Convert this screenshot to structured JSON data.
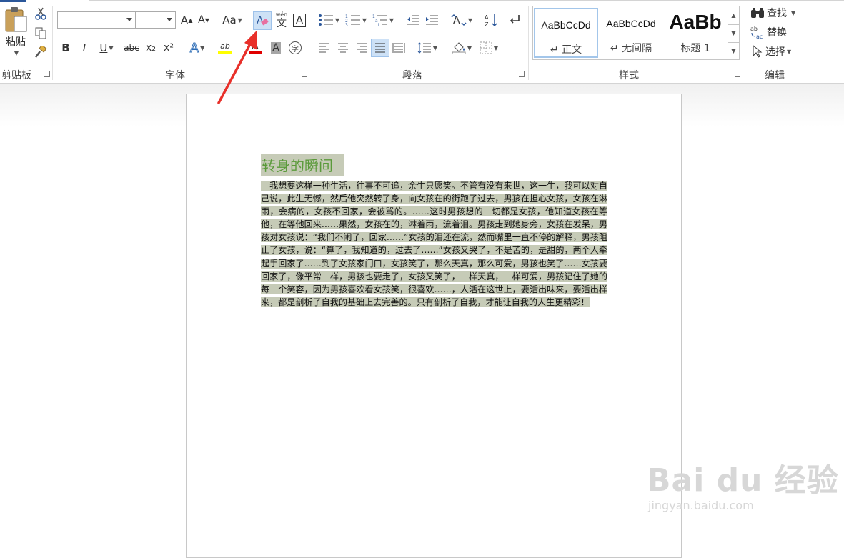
{
  "ribbon": {
    "clipboard": {
      "paste_label": "粘贴",
      "group_label": "剪贴板"
    },
    "font": {
      "font_name": "",
      "font_size": "",
      "grow_label": "A",
      "shrink_label": "A",
      "case_label": "Aa",
      "phonetic_top": "wén",
      "phonetic_bottom": "文",
      "border_char": "A",
      "bold": "B",
      "italic": "I",
      "underline": "U",
      "strike": "abc",
      "subscript": "x₂",
      "superscript": "x²",
      "effects": "A",
      "highlight": "ab",
      "font_color": "A",
      "shading_char": "A",
      "enclose_char": "字",
      "group_label": "字体"
    },
    "paragraph": {
      "group_label": "段落"
    },
    "styles": {
      "items": [
        {
          "preview": "AaBbCcDd",
          "name": "↵ 正文"
        },
        {
          "preview": "AaBbCcDd",
          "name": "↵ 无间隔"
        },
        {
          "preview": "AaBb",
          "name": "标题 1"
        }
      ],
      "group_label": "样式"
    },
    "editing": {
      "find_label": "查找",
      "replace_label": "替换",
      "select_label": "选择",
      "group_label": "编辑"
    }
  },
  "document": {
    "title": "转身的瞬间",
    "body": "　我想要这样一种生活，往事不可追，余生只愿笑。不管有没有来世，这一生，我可以对自己说，此生无憾，然后他突然转了身，向女孩在的街跑了过去，男孩在担心女孩，女孩在淋雨，会病的，女孩不回家，会被骂的。……这时男孩想的一切都是女孩，他知道女孩在等他，在等他回来……果然，女孩在的，淋着雨，流着泪。男孩走到她身旁，女孩在发呆，男孩对女孩说：“我们不闹了，回家……”女孩的泪还在流，然而嘴里一直不停的解释，男孩阻止了女孩，说：“算了，我知道的，过去了……”女孩又哭了，不是苦的，是甜的，两个人牵起手回家了……到了女孩家门口，女孩笑了，那么天真，那么可爱，男孩也笑了……女孩要回家了，像平常一样，男孩也要走了，女孩又笑了，一样天真，一样可爱，男孩记住了她的每一个笑容，因为男孩喜欢看女孩笑，很喜欢……，人活在这世上，要活出味来，要活出样来，都是剖析了自我的基础上去完善的。只有剖析了自我，才能让自我的人生更精彩！"
  },
  "watermark": {
    "brand": "Bai du 经验",
    "url": "jingyan.baidu.com"
  },
  "colors": {
    "selection": "#c6cbb7",
    "title_green": "#5a9a3a",
    "arrow_red": "#e8302a"
  }
}
